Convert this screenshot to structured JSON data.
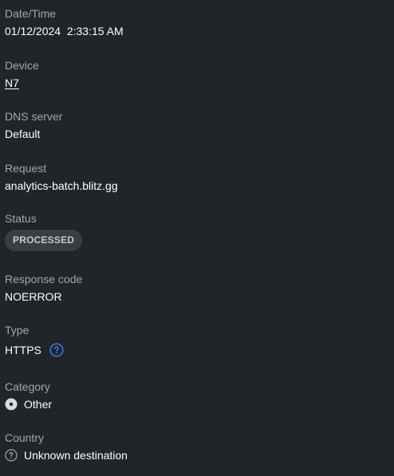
{
  "fields": {
    "datetime": {
      "label": "Date/Time",
      "value": "01/12/2024  2:33:15 AM"
    },
    "device": {
      "label": "Device",
      "value": "N7"
    },
    "dns": {
      "label": "DNS server",
      "value": "Default"
    },
    "request": {
      "label": "Request",
      "value": "analytics-batch.blitz.gg"
    },
    "status": {
      "label": "Status",
      "value": "PROCESSED"
    },
    "response": {
      "label": "Response code",
      "value": "NOERROR"
    },
    "type": {
      "label": "Type",
      "value": "HTTPS"
    },
    "category": {
      "label": "Category",
      "value": "Other"
    },
    "country": {
      "label": "Country",
      "value": "Unknown destination"
    }
  },
  "icons": {
    "type_help": "question-circle-icon",
    "category": "filled-dot-circle-icon",
    "country": "question-circle-icon"
  },
  "colors": {
    "background": "#212429",
    "label": "#a3a7ad",
    "value": "#ffffff",
    "badge_bg": "#3a3d43",
    "badge_text": "#c5c8cd",
    "accent": "#3b82f6"
  }
}
